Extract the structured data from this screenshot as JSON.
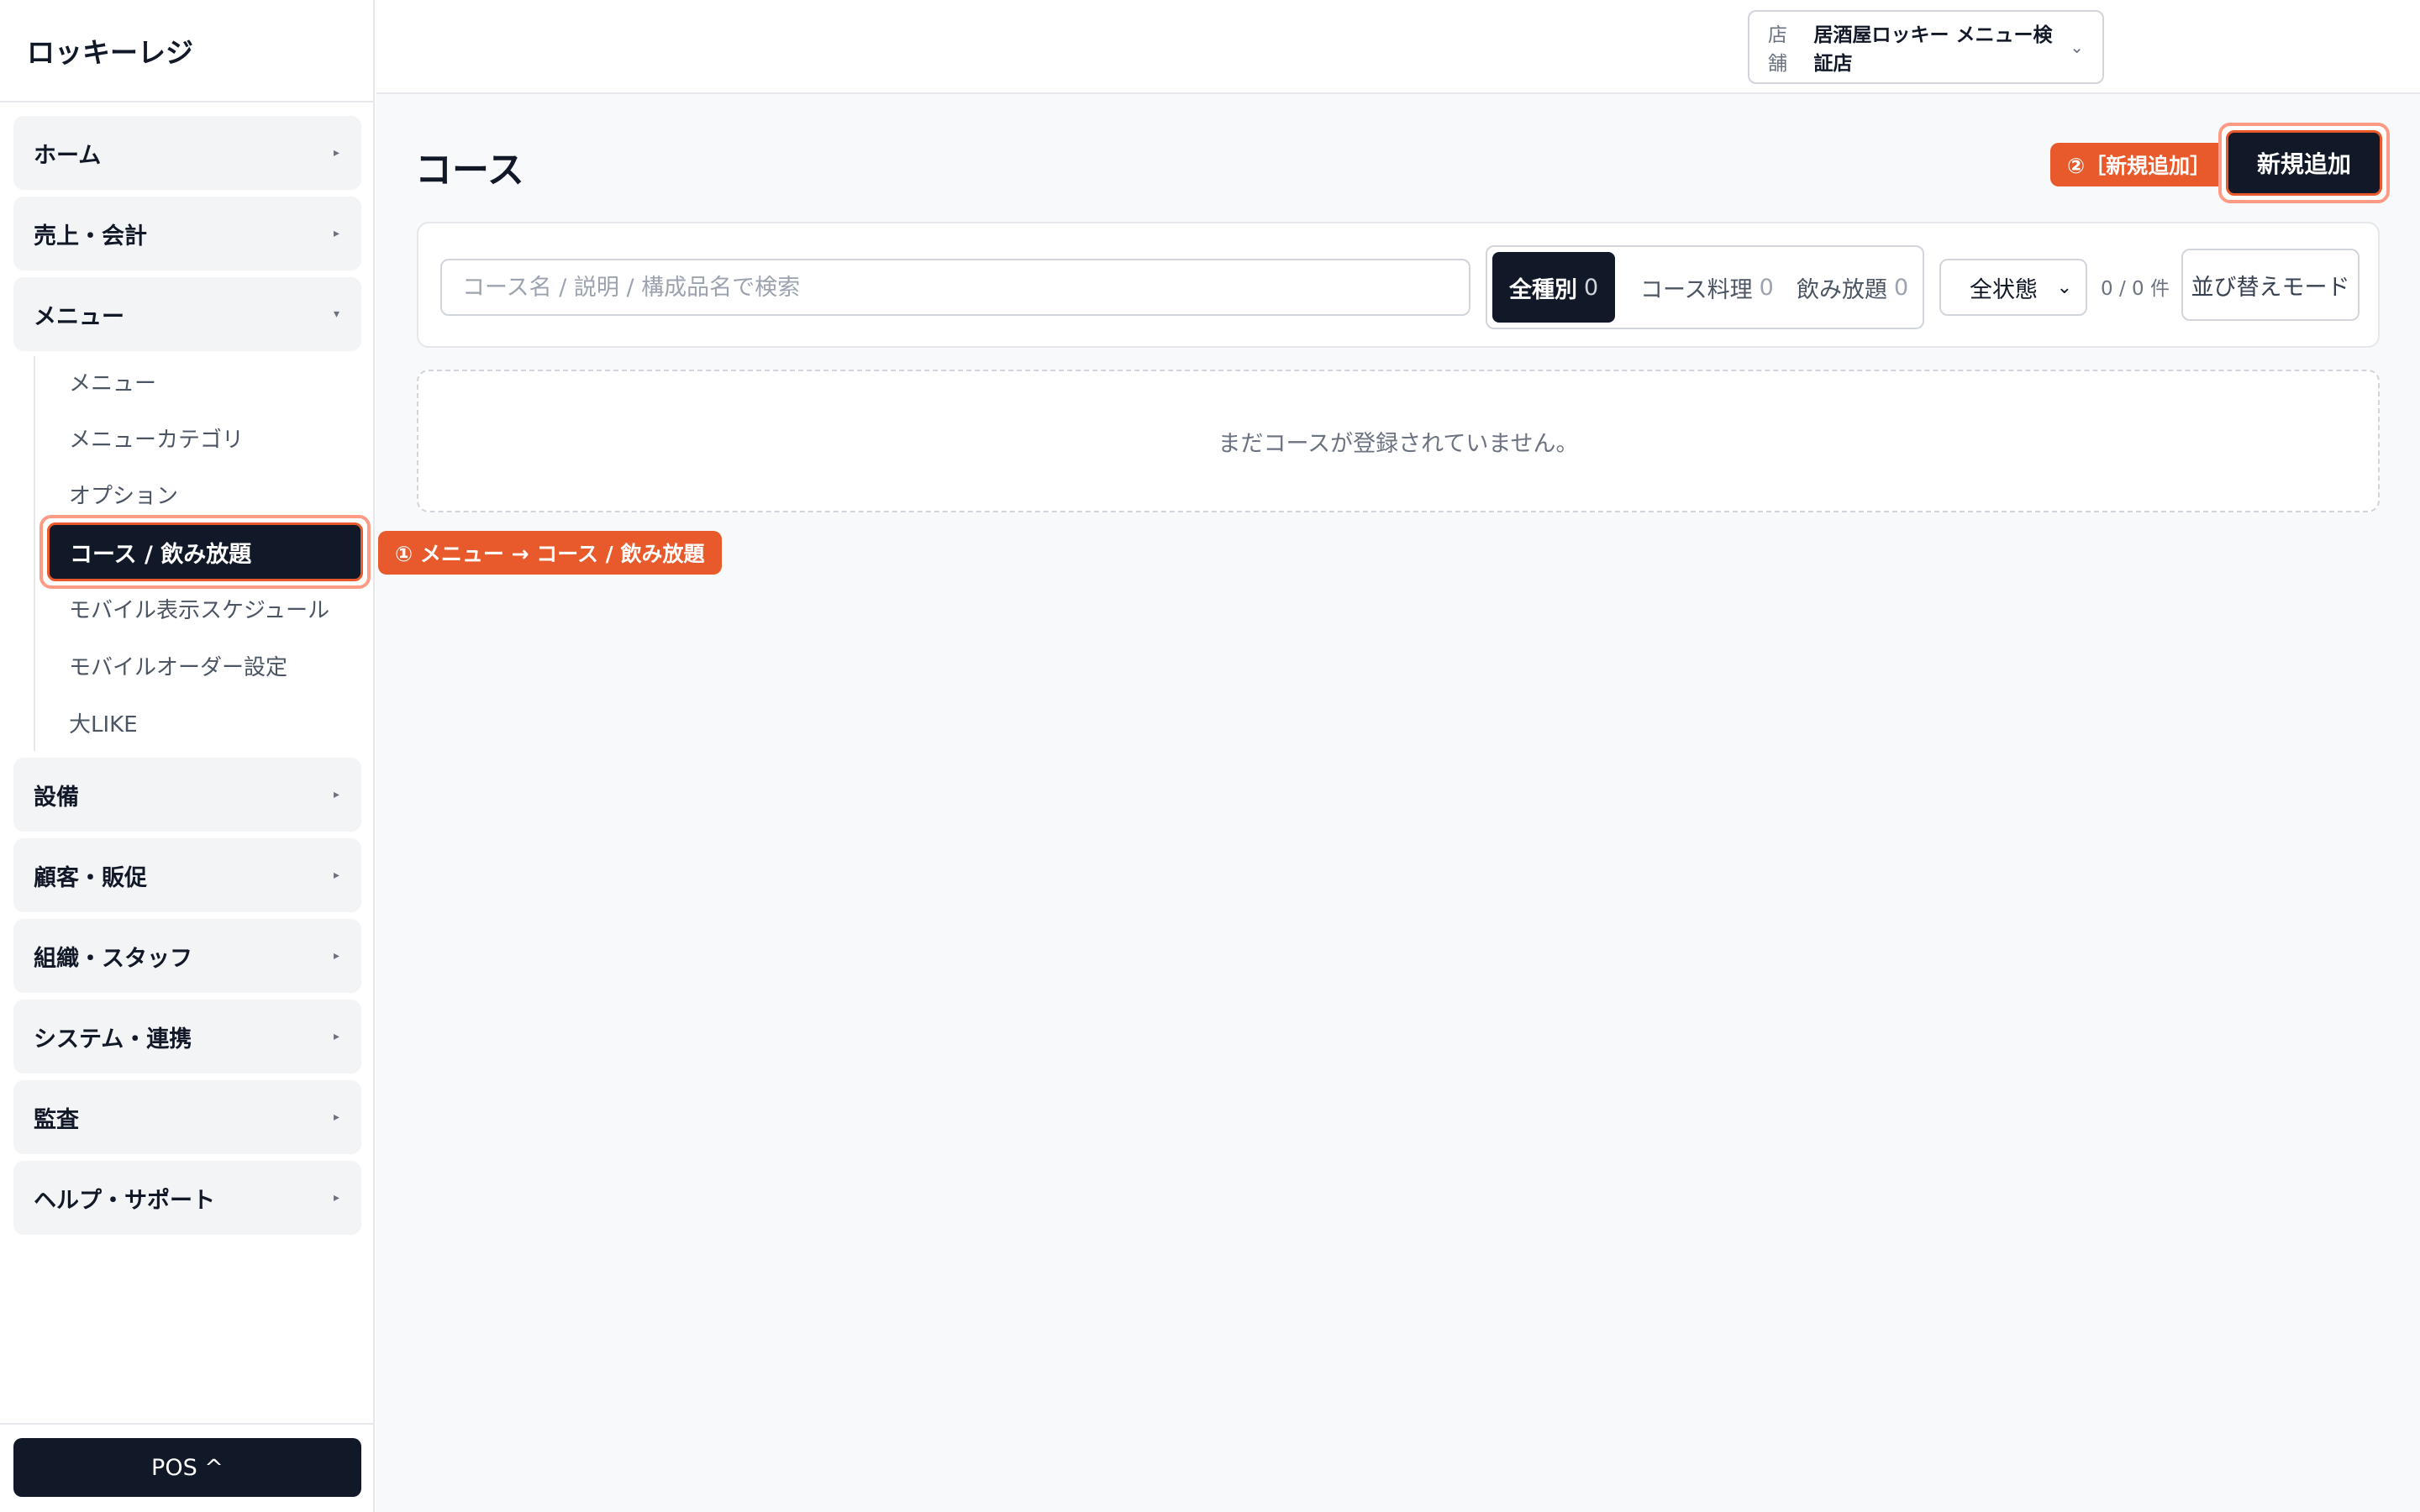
{
  "app": {
    "brand": "ロッキーレジ"
  },
  "header": {
    "store_label": "店舗",
    "store_name": "居酒屋ロッキー メニュー検証店",
    "chevron_icon": "chevron-down-icon"
  },
  "sidebar": {
    "items": [
      {
        "label": "ホーム",
        "expanded": false
      },
      {
        "label": "売上・会計",
        "expanded": false
      },
      {
        "label": "メニュー",
        "expanded": true
      },
      {
        "label": "設備",
        "expanded": false
      },
      {
        "label": "顧客・販促",
        "expanded": false
      },
      {
        "label": "組織・スタッフ",
        "expanded": false
      },
      {
        "label": "システム・連携",
        "expanded": false
      },
      {
        "label": "監査",
        "expanded": false
      },
      {
        "label": "ヘルプ・サポート",
        "expanded": false
      }
    ],
    "caret_collapsed": "▸",
    "caret_expanded": "▾",
    "menu_sub": [
      "メニュー",
      "メニューカテゴリ",
      "オプション",
      "コース / 飲み放題",
      "モバイル表示スケジュール",
      "モバイルオーダー設定",
      "大LIKE"
    ],
    "active_sub": "コース / 飲み放題",
    "pos_button": "POS ^"
  },
  "annotations": {
    "step1": "① メニュー → コース / 飲み放題",
    "step2": "②［新規追加］",
    "color": "#e85a2c"
  },
  "main": {
    "title": "コース",
    "new_button": "新規追加",
    "search_placeholder": "コース名 / 説明 / 構成品名で検索",
    "filters": [
      {
        "label": "全種別",
        "count": "0",
        "active": true
      },
      {
        "label": "コース料理",
        "count": "0",
        "active": false
      },
      {
        "label": "飲み放題",
        "count": "0",
        "active": false
      }
    ],
    "status_select": "全状態",
    "count_text": "0 / 0 件",
    "sort_button": "並び替えモード",
    "empty_message": "まだコースが登録されていません。"
  }
}
